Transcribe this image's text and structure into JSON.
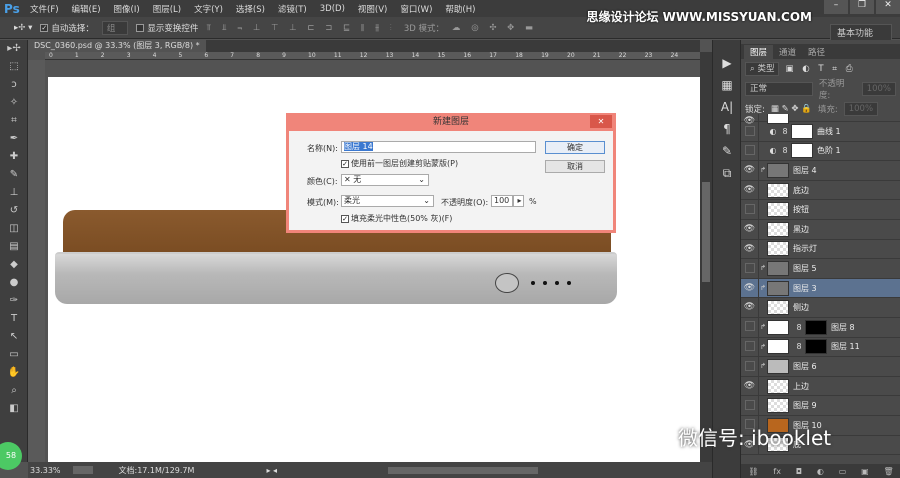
{
  "app": {
    "logo": "Ps"
  },
  "menu": [
    "文件(F)",
    "编辑(E)",
    "图像(I)",
    "图层(L)",
    "文字(Y)",
    "选择(S)",
    "滤镜(T)",
    "3D(D)",
    "视图(V)",
    "窗口(W)",
    "帮助(H)"
  ],
  "window_controls": [
    "–",
    "❐",
    "✕"
  ],
  "options": {
    "auto_select_label": "自动选择：",
    "auto_select_value": "组",
    "show_transform_label": "显示变换控件",
    "align_icons": "⫪ ⫫ ⫬ ⊥ ⊤ ⊥  ⊏ ⊐ ⊑  ⫴ ⫵ ⫶",
    "mode3d_label": "3D 模式：",
    "mode3d_icons": "☁ ◎ ✣ ✥ ▬",
    "workspace": "基本功能"
  },
  "watermark_top": "思缘设计论坛 WWW.MISSYUAN.COM",
  "document": {
    "tab": "DSC_0360.psd @ 33.3% (图层 3, RGB/8) *",
    "ruler_ticks": [
      "0",
      "1",
      "2",
      "3",
      "4",
      "5",
      "6",
      "7",
      "8",
      "9",
      "10",
      "11",
      "12",
      "13",
      "14",
      "15",
      "16",
      "17",
      "18",
      "19",
      "20",
      "21",
      "22",
      "23",
      "24"
    ]
  },
  "status": {
    "zoom": "33.33%",
    "doc_size": "文档:17.1M/129.7M"
  },
  "dialog": {
    "title": "新建图层",
    "close": "✕",
    "name_label": "名称(N):",
    "name_value": "图层 14",
    "clip_label": "使用前一图层创建剪贴蒙版(P)",
    "color_label": "颜色(C):",
    "color_value": "✕ 无",
    "mode_label": "模式(M):",
    "mode_value": "柔光",
    "opacity_label": "不透明度(O):",
    "opacity_value": "100",
    "opacity_unit": "%",
    "fill_label": "填充柔光中性色(50% 灰)(F)",
    "ok": "确定",
    "cancel": "取消"
  },
  "layers_panel": {
    "tabs": [
      "图层",
      "通道",
      "路径"
    ],
    "filter": "⌕ 类型",
    "filter_icons": "▣ ◐ T ⌗ ⎙",
    "blend": "正常",
    "opacity_label": "不透明度:",
    "opacity": "100%",
    "lock_label": "锁定:",
    "lock_icons": "▦ ✎ ✥ 🔒",
    "fill_label": "填充:",
    "fill": "100%",
    "layers": [
      {
        "name": "",
        "visible": true,
        "type": "partial"
      },
      {
        "name": "曲线 1",
        "visible": false,
        "type": "adjust"
      },
      {
        "name": "色阶 1",
        "visible": false,
        "type": "adjust"
      },
      {
        "name": "图层 4",
        "visible": true,
        "type": "gray",
        "clip": true
      },
      {
        "name": "底边",
        "visible": true,
        "type": "check"
      },
      {
        "name": "按钮",
        "visible": false,
        "type": "check"
      },
      {
        "name": "黑边",
        "visible": true,
        "type": "check"
      },
      {
        "name": "指示灯",
        "visible": true,
        "type": "check"
      },
      {
        "name": "图层 5",
        "visible": false,
        "type": "gray",
        "clip": true
      },
      {
        "name": "图层 3",
        "visible": true,
        "type": "gray",
        "clip": true,
        "selected": true
      },
      {
        "name": "侧边",
        "visible": true,
        "type": "check"
      },
      {
        "name": "图层 8",
        "visible": false,
        "type": "masked",
        "clip": true
      },
      {
        "name": "图层 11",
        "visible": false,
        "type": "masked",
        "clip": true
      },
      {
        "name": "图层 6",
        "visible": false,
        "type": "lightgray",
        "clip": true
      },
      {
        "name": "上边",
        "visible": true,
        "type": "check"
      },
      {
        "name": "图层 9",
        "visible": false,
        "type": "check"
      },
      {
        "name": "图层 10",
        "visible": false,
        "type": "brown"
      },
      {
        "name": "底",
        "visible": true,
        "type": "check"
      }
    ],
    "bottom_icons": [
      "⛓",
      "fx",
      "◘",
      "◐",
      "▭",
      "▣",
      "🗑"
    ]
  },
  "watermark_bottom": "微信号: ibooklet",
  "badge": "58",
  "colors": {
    "dialog_title": "#f0857a",
    "selected_layer": "#5c7290",
    "product_top": "#7f5127"
  }
}
